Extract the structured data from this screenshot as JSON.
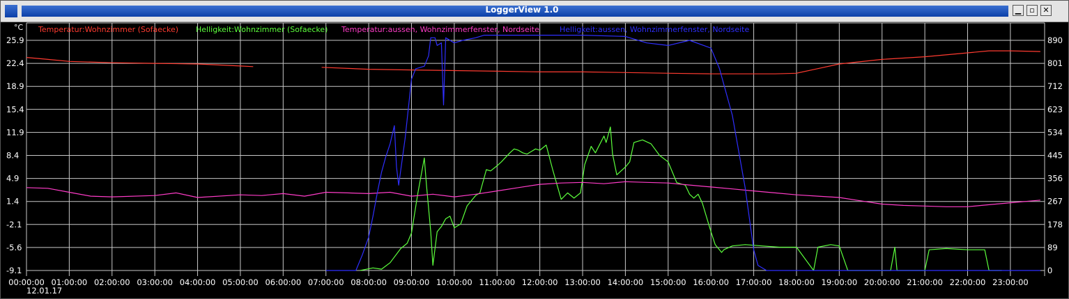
{
  "window": {
    "title": "LoggerView 1.0",
    "buttons": {
      "minimize": "▁",
      "maximize": "▫",
      "close": "✕"
    }
  },
  "colors": {
    "background": "#000000",
    "grid": "#c8c8c8",
    "axis_text": "#ffffff",
    "series": [
      "#ff3b30",
      "#5cff3c",
      "#ff3cc8",
      "#2f2fff"
    ]
  },
  "chart_data": {
    "type": "line",
    "title": "",
    "y_unit_label": "°C",
    "date_label": "12.01.17",
    "x_ticks": [
      "00:00:00",
      "01:00:00",
      "02:00:00",
      "03:00:00",
      "04:00:00",
      "05:00:00",
      "06:00:00",
      "07:00:00",
      "08:00:00",
      "09:00:00",
      "10:00:00",
      "11:00:00",
      "12:00:00",
      "13:00:00",
      "14:00:00",
      "15:00:00",
      "16:00:00",
      "17:00:00",
      "18:00:00",
      "19:00:00",
      "20:00:00",
      "21:00:00",
      "22:00:00",
      "23:00:00"
    ],
    "xlim_hours": [
      0,
      23.8
    ],
    "left_axis": {
      "ticks": [
        "25.9",
        "22.4",
        "18.9",
        "15.4",
        "11.9",
        "8.4",
        "4.9",
        "1.4",
        "-2.1",
        "-5.6",
        "-9.1"
      ],
      "ylim": [
        -9.1,
        25.9
      ]
    },
    "right_axis": {
      "ticks": [
        "890",
        "801",
        "712",
        "623",
        "534",
        "445",
        "356",
        "267",
        "178",
        "89",
        "0"
      ],
      "ylim": [
        0,
        890
      ]
    },
    "grid": true,
    "legend_position": "top",
    "series": [
      {
        "name": "Temperatur:Wohnzimmer (Sofaecke)",
        "axis": "left",
        "segments": [
          [
            [
              0,
              23.3
            ],
            [
              0.5,
              23.0
            ],
            [
              1,
              22.7
            ],
            [
              2,
              22.5
            ],
            [
              3,
              22.4
            ],
            [
              4,
              22.3
            ],
            [
              5,
              22.0
            ],
            [
              5.3,
              21.9
            ]
          ],
          [
            [
              6.9,
              21.8
            ],
            [
              8,
              21.5
            ],
            [
              9,
              21.4
            ],
            [
              10,
              21.3
            ],
            [
              11,
              21.2
            ],
            [
              12,
              21.1
            ],
            [
              13,
              21.1
            ],
            [
              14,
              21.0
            ],
            [
              15,
              20.9
            ],
            [
              16,
              20.8
            ],
            [
              17,
              20.8
            ],
            [
              17.5,
              20.8
            ],
            [
              18.0,
              20.9
            ],
            [
              18.5,
              21.6
            ],
            [
              19,
              22.3
            ],
            [
              20,
              23.0
            ],
            [
              21,
              23.4
            ],
            [
              22,
              24.0
            ],
            [
              22.5,
              24.3
            ],
            [
              23,
              24.3
            ],
            [
              23.7,
              24.2
            ]
          ]
        ]
      },
      {
        "name": "Helligkeit:Wohnzimmer (Sofaecke)",
        "axis": "right",
        "segments": [
          [
            [
              7.8,
              0
            ],
            [
              8.1,
              10
            ],
            [
              8.3,
              5
            ],
            [
              8.5,
              30
            ],
            [
              8.75,
              85
            ],
            [
              8.9,
              105
            ],
            [
              9.0,
              145
            ],
            [
              9.15,
              300
            ],
            [
              9.3,
              435
            ],
            [
              9.35,
              330
            ],
            [
              9.45,
              150
            ],
            [
              9.5,
              20
            ],
            [
              9.6,
              150
            ],
            [
              9.7,
              170
            ],
            [
              9.8,
              200
            ],
            [
              9.9,
              210
            ],
            [
              10.0,
              165
            ],
            [
              10.15,
              180
            ],
            [
              10.3,
              250
            ],
            [
              10.5,
              290
            ],
            [
              10.6,
              300
            ],
            [
              10.75,
              390
            ],
            [
              10.85,
              385
            ],
            [
              11.0,
              405
            ],
            [
              11.1,
              420
            ],
            [
              11.3,
              455
            ],
            [
              11.4,
              470
            ],
            [
              11.5,
              465
            ],
            [
              11.6,
              455
            ],
            [
              11.7,
              450
            ],
            [
              11.8,
              460
            ],
            [
              11.9,
              470
            ],
            [
              12.0,
              465
            ],
            [
              12.15,
              485
            ],
            [
              12.3,
              390
            ],
            [
              12.5,
              275
            ],
            [
              12.65,
              300
            ],
            [
              12.8,
              280
            ],
            [
              12.95,
              300
            ],
            [
              13.05,
              410
            ],
            [
              13.2,
              480
            ],
            [
              13.3,
              455
            ],
            [
              13.5,
              520
            ],
            [
              13.55,
              495
            ],
            [
              13.65,
              555
            ],
            [
              13.7,
              450
            ],
            [
              13.8,
              370
            ],
            [
              14.0,
              400
            ],
            [
              14.1,
              420
            ],
            [
              14.2,
              495
            ],
            [
              14.4,
              505
            ],
            [
              14.6,
              490
            ],
            [
              14.8,
              445
            ],
            [
              15.0,
              420
            ],
            [
              15.2,
              340
            ],
            [
              15.4,
              330
            ],
            [
              15.5,
              295
            ],
            [
              15.6,
              280
            ],
            [
              15.7,
              295
            ],
            [
              15.8,
              260
            ],
            [
              16.0,
              150
            ],
            [
              16.1,
              100
            ],
            [
              16.25,
              70
            ],
            [
              16.3,
              80
            ],
            [
              16.5,
              95
            ],
            [
              16.8,
              100
            ],
            [
              17.2,
              95
            ],
            [
              17.6,
              90
            ],
            [
              18.0,
              90
            ],
            [
              18.4,
              0
            ],
            [
              18.5,
              90
            ],
            [
              18.8,
              100
            ],
            [
              19.0,
              95
            ],
            [
              19.2,
              0
            ],
            [
              19.5,
              0
            ],
            [
              20.0,
              0
            ],
            [
              20.2,
              0
            ],
            [
              20.3,
              90
            ],
            [
              20.35,
              0
            ],
            [
              20.6,
              0
            ],
            [
              21.0,
              0
            ],
            [
              21.1,
              80
            ],
            [
              21.5,
              85
            ],
            [
              22.0,
              80
            ],
            [
              22.4,
              80
            ],
            [
              22.5,
              0
            ],
            [
              22.8,
              0
            ]
          ]
        ]
      },
      {
        "name": "Temperatur:aussen, Wohnzimmerfenster, Nordseite",
        "axis": "left",
        "segments": [
          [
            [
              0,
              3.5
            ],
            [
              0.5,
              3.4
            ],
            [
              1,
              2.8
            ],
            [
              1.5,
              2.2
            ],
            [
              2,
              2.1
            ],
            [
              3,
              2.3
            ],
            [
              3.5,
              2.7
            ],
            [
              4,
              2.0
            ],
            [
              5,
              2.4
            ],
            [
              5.5,
              2.3
            ],
            [
              6,
              2.6
            ],
            [
              6.5,
              2.2
            ],
            [
              7,
              2.8
            ],
            [
              7.5,
              2.7
            ],
            [
              8,
              2.6
            ],
            [
              8.5,
              2.8
            ],
            [
              9,
              2.2
            ],
            [
              9.5,
              2.5
            ],
            [
              10,
              2.1
            ],
            [
              10.5,
              2.5
            ],
            [
              11,
              3.0
            ],
            [
              11.5,
              3.5
            ],
            [
              12,
              4.0
            ],
            [
              12.5,
              4.2
            ],
            [
              13,
              4.3
            ],
            [
              13.5,
              4.1
            ],
            [
              14,
              4.4
            ],
            [
              14.5,
              4.3
            ],
            [
              15,
              4.2
            ],
            [
              15.5,
              3.9
            ],
            [
              16,
              3.6
            ],
            [
              16.5,
              3.3
            ],
            [
              17,
              3.0
            ],
            [
              17.5,
              2.7
            ],
            [
              18,
              2.4
            ],
            [
              18.5,
              2.2
            ],
            [
              19,
              2.0
            ],
            [
              19.5,
              1.5
            ],
            [
              20,
              1.0
            ],
            [
              20.5,
              0.8
            ],
            [
              21,
              0.7
            ],
            [
              21.5,
              0.6
            ],
            [
              22,
              0.6
            ],
            [
              22.5,
              0.9
            ],
            [
              23,
              1.2
            ],
            [
              23.7,
              1.6
            ]
          ]
        ]
      },
      {
        "name": "Helligkeit:aussen, Wohnzimmerfenster, Nordseite",
        "axis": "right",
        "segments": [
          [
            [
              7.0,
              0
            ],
            [
              7.7,
              0
            ],
            [
              7.85,
              60
            ],
            [
              8.0,
              130
            ],
            [
              8.1,
              210
            ],
            [
              8.2,
              300
            ],
            [
              8.3,
              380
            ],
            [
              8.4,
              440
            ],
            [
              8.5,
              490
            ],
            [
              8.6,
              560
            ],
            [
              8.65,
              400
            ],
            [
              8.7,
              330
            ],
            [
              8.85,
              510
            ],
            [
              9.0,
              740
            ],
            [
              9.1,
              780
            ],
            [
              9.3,
              790
            ],
            [
              9.4,
              830
            ],
            [
              9.45,
              900
            ],
            [
              9.55,
              900
            ],
            [
              9.6,
              870
            ],
            [
              9.7,
              880
            ],
            [
              9.75,
              640
            ],
            [
              9.8,
              900
            ],
            [
              10.0,
              880
            ],
            [
              10.2,
              890
            ],
            [
              10.5,
              900
            ],
            [
              10.7,
              910
            ],
            [
              11.0,
              910
            ],
            [
              12.0,
              910
            ],
            [
              13.0,
              910
            ],
            [
              14.0,
              905
            ],
            [
              14.5,
              880
            ],
            [
              15.0,
              870
            ],
            [
              15.5,
              890
            ],
            [
              16.0,
              860
            ],
            [
              16.2,
              780
            ],
            [
              16.5,
              600
            ],
            [
              16.8,
              320
            ],
            [
              17.0,
              80
            ],
            [
              17.1,
              20
            ],
            [
              17.3,
              0
            ],
            [
              18.0,
              0
            ],
            [
              19.0,
              0
            ],
            [
              20.0,
              0
            ],
            [
              22.0,
              0
            ],
            [
              23.7,
              0
            ]
          ]
        ]
      }
    ]
  }
}
